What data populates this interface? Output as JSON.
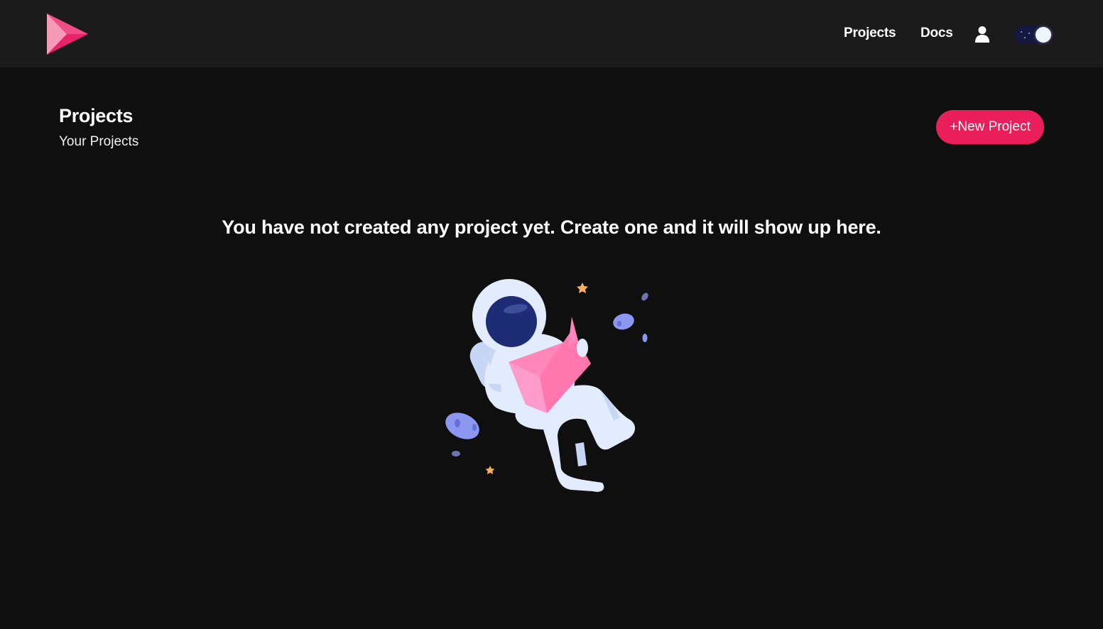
{
  "header": {
    "nav": {
      "projects_label": "Projects",
      "docs_label": "Docs"
    },
    "icons": {
      "logo": "play-triangle-logo",
      "user": "user-icon",
      "theme_toggle": "dark-mode-toggle"
    },
    "theme_toggle_state": "dark"
  },
  "page": {
    "title": "Projects",
    "subtitle": "Your Projects",
    "new_project_label": "+New Project",
    "empty_message": "You have not created any project yet. Create one and it will show up here."
  },
  "colors": {
    "accent": "#e91e5a",
    "topbar_bg": "#1b1b1b",
    "page_bg": "#0f0f10"
  }
}
